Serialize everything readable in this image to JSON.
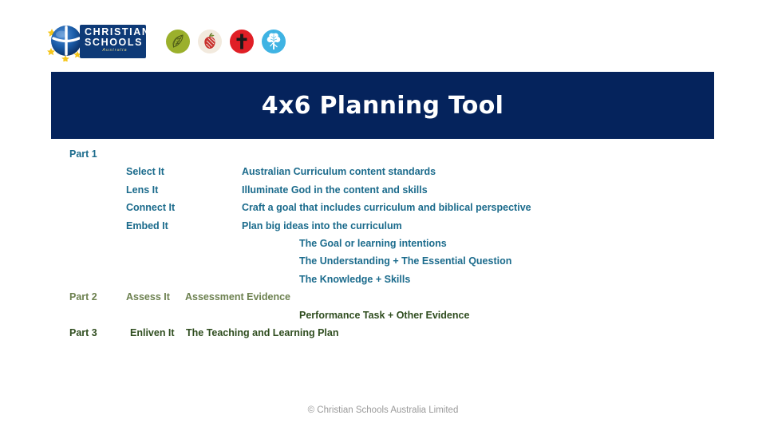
{
  "header": {
    "logo": {
      "name": "christian-schools-australia-logo",
      "line1": "CHRISTIAN",
      "line2": "SCHOOLS",
      "line3": "Australia"
    },
    "icons": [
      {
        "name": "leaf-icon",
        "color": "#9bb02c"
      },
      {
        "name": "apple-icon",
        "color": "#f2eade"
      },
      {
        "name": "cross-icon",
        "color": "#e01f26"
      },
      {
        "name": "tree-icon",
        "color": "#3fb3e3"
      }
    ]
  },
  "banner": {
    "title": "4x6 Planning Tool",
    "background": "#05235c",
    "text_color": "#ffffff"
  },
  "colors": {
    "part1_teal": "#1b6b8c",
    "part2_olive": "#6d8150",
    "part3_green": "#2f4d1f",
    "footer_gray": "#9a9a9a"
  },
  "parts": [
    {
      "part_label": "Part 1",
      "color": "#1b6b8c",
      "rows": [
        {
          "label": "Select It",
          "description": "Australian Curriculum content standards"
        },
        {
          "label": "Lens It",
          "description": "Illuminate God in the content and skills"
        },
        {
          "label": "Connect It",
          "description": "Craft a goal that includes curriculum and biblical perspective"
        },
        {
          "label": "Embed It",
          "description": "Plan big ideas into the curriculum"
        }
      ],
      "sub_rows": [
        "The Goal or learning intentions",
        "The Understanding + The Essential Question",
        "The Knowledge +  Skills"
      ]
    },
    {
      "part_label": "Part 2",
      "color": "#6d8150",
      "rows": [
        {
          "label": "Assess It",
          "description": "Assessment Evidence"
        }
      ],
      "sub_rows": [
        "Performance Task + Other Evidence"
      ]
    },
    {
      "part_label": "Part 3",
      "color": "#2f4d1f",
      "rows": [
        {
          "label": "Enliven It",
          "description": "The Teaching and Learning Plan"
        }
      ],
      "sub_rows": []
    }
  ],
  "footer": {
    "copyright": "© Christian Schools Australia Limited"
  }
}
